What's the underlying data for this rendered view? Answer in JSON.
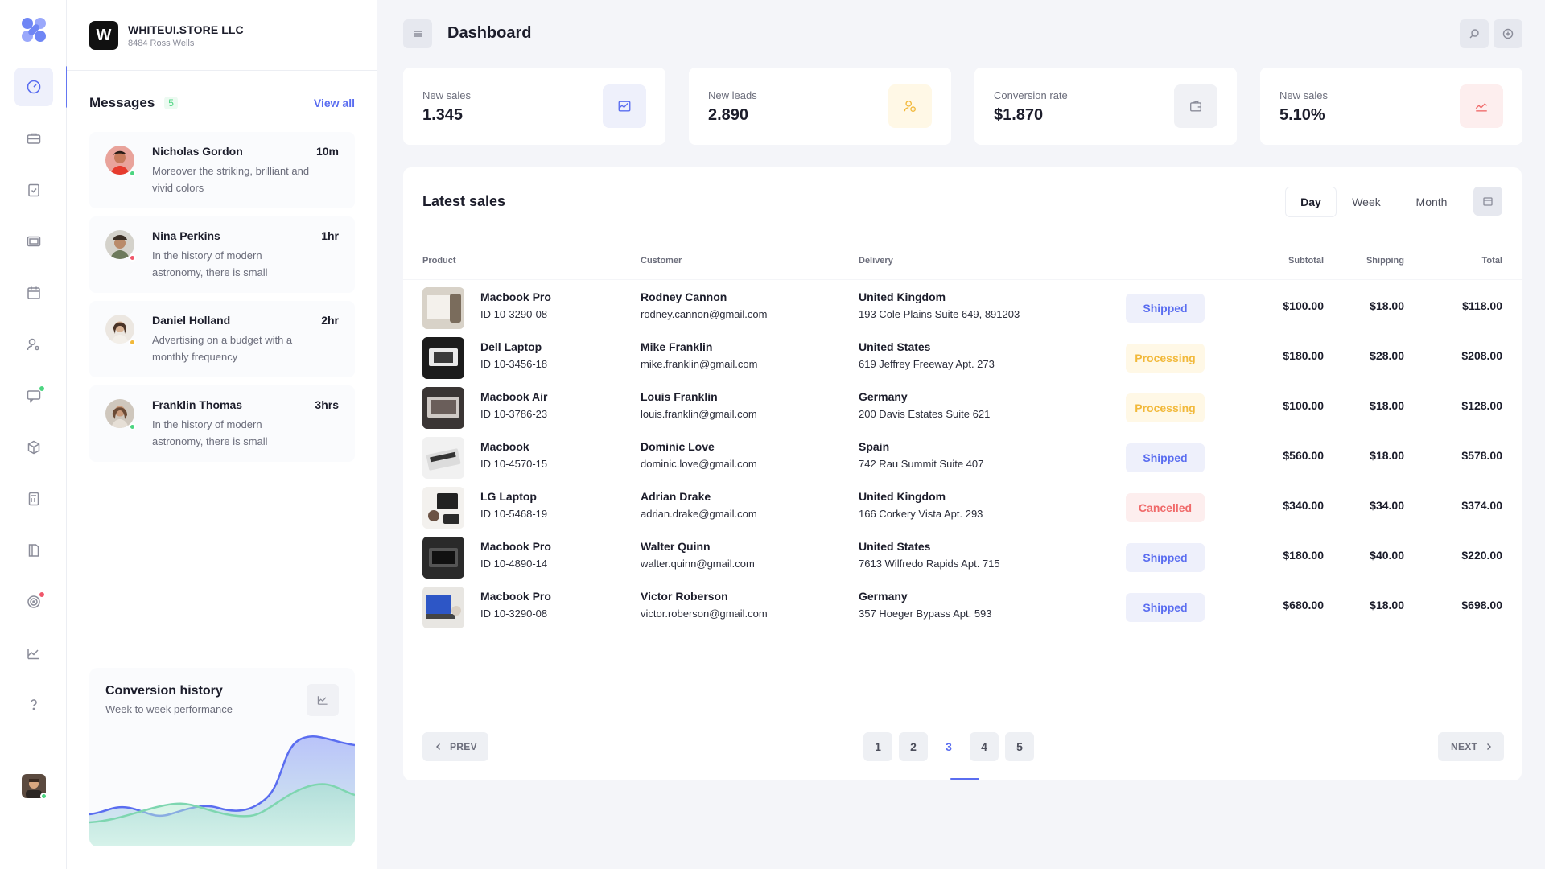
{
  "company": {
    "badge": "W",
    "name": "WHITEUI.STORE LLC",
    "address": "8484 Ross Wells"
  },
  "messages": {
    "title": "Messages",
    "count": "5",
    "view_all": "View all",
    "items": [
      {
        "name": "Nicholas Gordon",
        "time": "10m",
        "text": "Moreover the striking, brilliant and vivid colors",
        "status_color": "#4cd581"
      },
      {
        "name": "Nina Perkins",
        "time": "1hr",
        "text": "In the history of modern astronomy, there is small",
        "status_color": "#f0576b"
      },
      {
        "name": "Daniel Holland",
        "time": "2hr",
        "text": "Advertising on a budget with a monthly frequency",
        "status_color": "#f2b93b"
      },
      {
        "name": "Franklin Thomas",
        "time": "3hrs",
        "text": "In the history of modern astronomy, there is small",
        "status_color": "#4cd581"
      }
    ]
  },
  "conversion": {
    "title": "Conversion history",
    "subtitle": "Week to week performance"
  },
  "header": {
    "title": "Dashboard"
  },
  "stats": [
    {
      "label": "New sales",
      "value": "1.345",
      "icon": "chart-icon",
      "color": "#5a6df0",
      "bg": "#eef0fb"
    },
    {
      "label": "New leads",
      "value": "2.890",
      "icon": "user-coin-icon",
      "color": "#f2b93b",
      "bg": "#fff8e6"
    },
    {
      "label": "Conversion rate",
      "value": "$1.870",
      "icon": "wallet-icon",
      "color": "#8a8c99",
      "bg": "#f0f1f5"
    },
    {
      "label": "New sales",
      "value": "5.10%",
      "icon": "trend-icon",
      "color": "#f06a6a",
      "bg": "#fdeeee"
    }
  ],
  "sales": {
    "title": "Latest sales",
    "tabs": [
      "Day",
      "Week",
      "Month"
    ],
    "active_tab": "Day",
    "columns": [
      "Product",
      "Customer",
      "Delivery",
      "Subtotal",
      "Shipping",
      "Total"
    ],
    "rows": [
      {
        "product": "Macbook Pro",
        "id": "ID 10-3290-08",
        "customer": "Rodney Cannon",
        "email": "rodney.cannon@gmail.com",
        "country": "United Kingdom",
        "address": "193 Cole Plains Suite 649, 891203",
        "status": "Shipped",
        "subtotal": "$100.00",
        "shipping": "$18.00",
        "total": "$118.00"
      },
      {
        "product": "Dell Laptop",
        "id": "ID 10-3456-18",
        "customer": "Mike Franklin",
        "email": "mike.franklin@gmail.com",
        "country": "United States",
        "address": "619 Jeffrey Freeway Apt. 273",
        "status": "Processing",
        "subtotal": "$180.00",
        "shipping": "$28.00",
        "total": "$208.00"
      },
      {
        "product": "Macbook Air",
        "id": "ID 10-3786-23",
        "customer": "Louis Franklin",
        "email": "louis.franklin@gmail.com",
        "country": "Germany",
        "address": "200 Davis Estates Suite 621",
        "status": "Processing",
        "subtotal": "$100.00",
        "shipping": "$18.00",
        "total": "$128.00"
      },
      {
        "product": "Macbook",
        "id": "ID 10-4570-15",
        "customer": "Dominic Love",
        "email": "dominic.love@gmail.com",
        "country": "Spain",
        "address": "742 Rau Summit Suite 407",
        "status": "Shipped",
        "subtotal": "$560.00",
        "shipping": "$18.00",
        "total": "$578.00"
      },
      {
        "product": "LG Laptop",
        "id": "ID 10-5468-19",
        "customer": "Adrian Drake",
        "email": "adrian.drake@gmail.com",
        "country": "United Kingdom",
        "address": "166 Corkery Vista Apt. 293",
        "status": "Cancelled",
        "subtotal": "$340.00",
        "shipping": "$34.00",
        "total": "$374.00"
      },
      {
        "product": "Macbook Pro",
        "id": "ID 10-4890-14",
        "customer": "Walter Quinn",
        "email": "walter.quinn@gmail.com",
        "country": "United States",
        "address": "7613 Wilfredo Rapids Apt. 715",
        "status": "Shipped",
        "subtotal": "$180.00",
        "shipping": "$40.00",
        "total": "$220.00"
      },
      {
        "product": "Macbook Pro",
        "id": "ID 10-3290-08",
        "customer": "Victor Roberson",
        "email": "victor.roberson@gmail.com",
        "country": "Germany",
        "address": "357 Hoeger Bypass Apt. 593",
        "status": "Shipped",
        "subtotal": "$680.00",
        "shipping": "$18.00",
        "total": "$698.00"
      }
    ],
    "pagination": {
      "prev": "PREV",
      "next": "NEXT",
      "pages": [
        "1",
        "2",
        "3",
        "4",
        "5"
      ],
      "current": "3"
    }
  }
}
